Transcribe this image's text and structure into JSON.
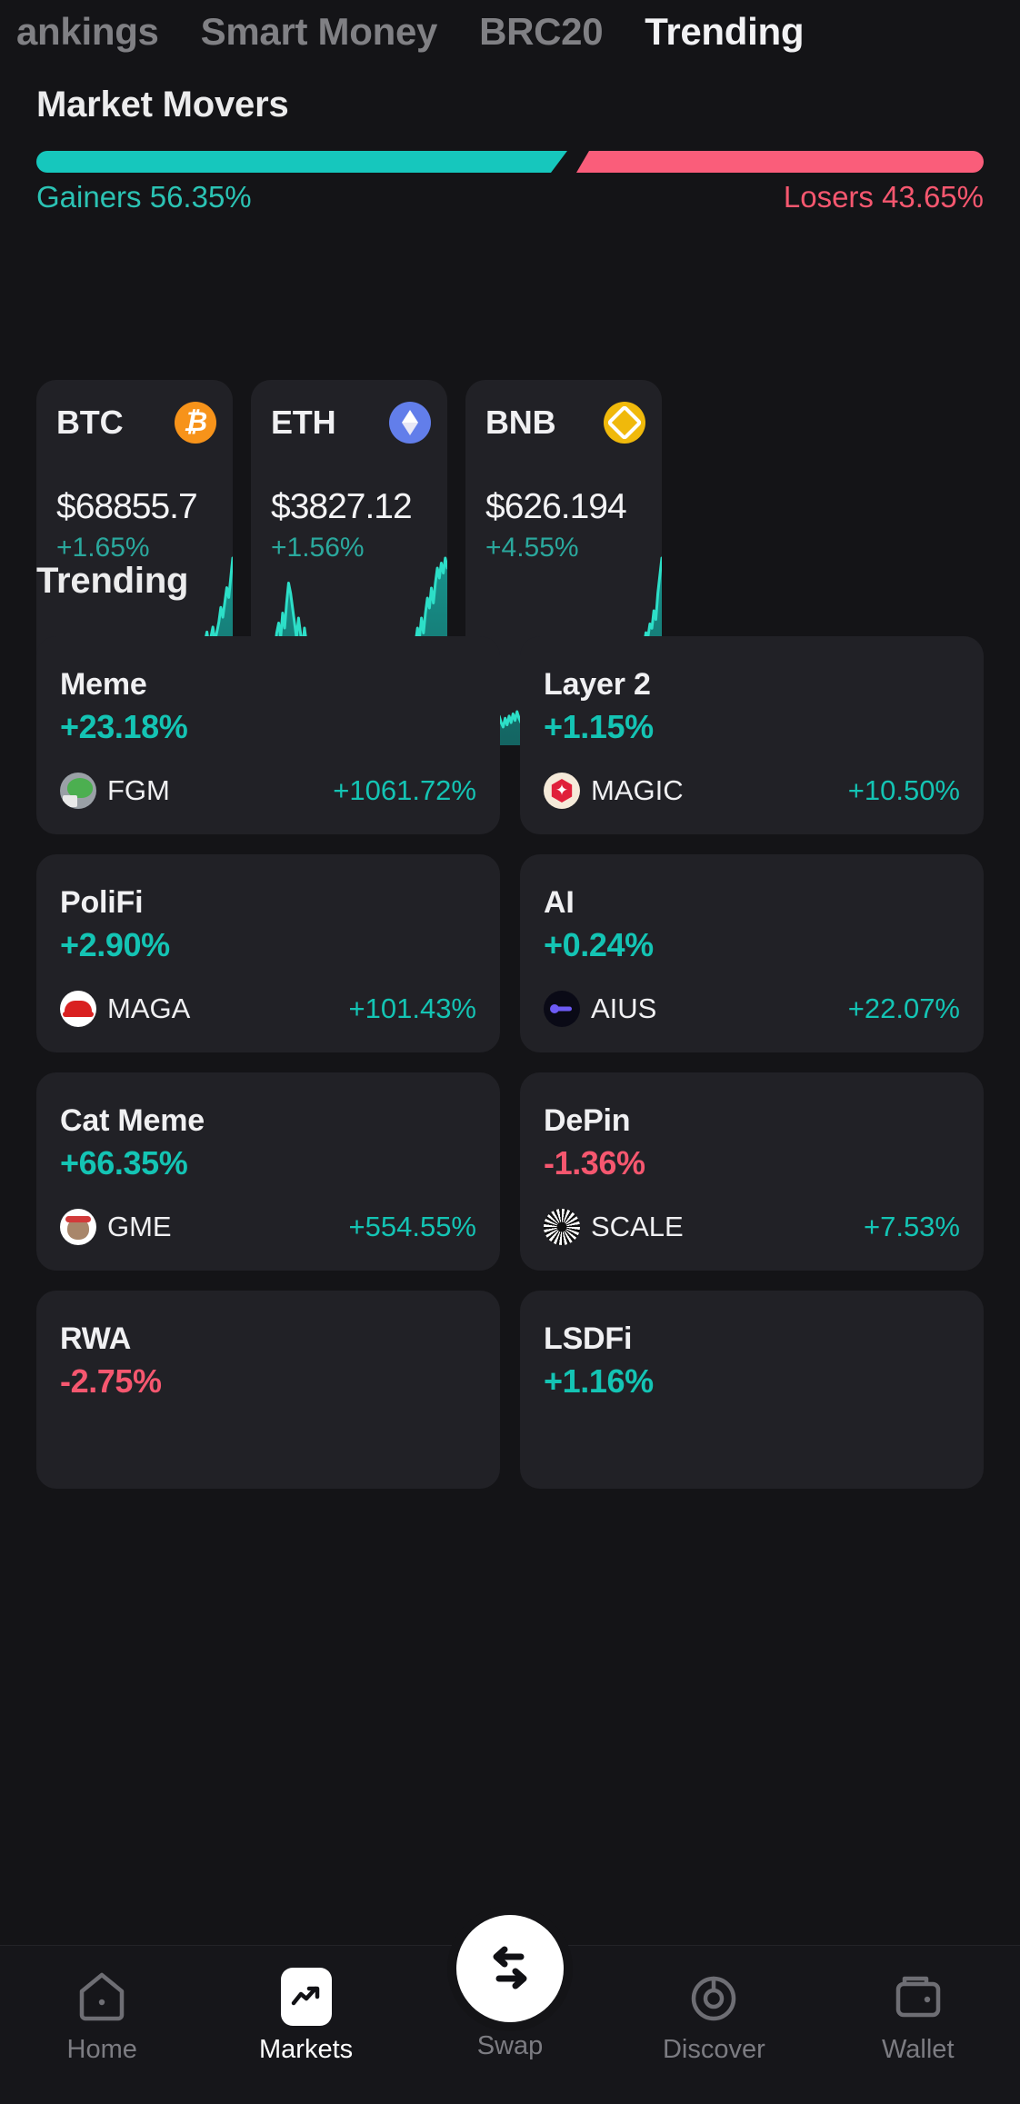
{
  "tabs": [
    {
      "label": "ankings",
      "active": false
    },
    {
      "label": "Smart Money",
      "active": false
    },
    {
      "label": "BRC20",
      "active": false
    },
    {
      "label": "Trending",
      "active": true
    }
  ],
  "market_movers": {
    "title": "Market Movers",
    "gainers_label": "Gainers 56.35%",
    "losers_label": "Losers 43.65%",
    "gainers_pct": 56.35,
    "losers_pct": 43.65,
    "gainers_color": "#16c7bd",
    "losers_color": "#fa5d7a",
    "cards": [
      {
        "symbol": "BTC",
        "price": "$68855.7",
        "change": "+1.65%",
        "icon": "bitcoin-icon",
        "icon_color": "#f7931a"
      },
      {
        "symbol": "ETH",
        "price": "$3827.12",
        "change": "+1.56%",
        "icon": "ethereum-icon",
        "icon_color": "#627eea"
      },
      {
        "symbol": "BNB",
        "price": "$626.194",
        "change": "+4.55%",
        "icon": "bnb-icon",
        "icon_color": "#f0b90b"
      }
    ]
  },
  "trending": {
    "title": "Trending",
    "cards": [
      {
        "name": "Meme",
        "change": "+23.18%",
        "dir": "up",
        "token": "FGM",
        "token_change": "+1061.72%",
        "token_dir": "up",
        "avatar": "pepe-avatar"
      },
      {
        "name": "Layer 2",
        "change": "+1.15%",
        "dir": "up",
        "token": "MAGIC",
        "token_change": "+10.50%",
        "token_dir": "up",
        "avatar": "magic-avatar"
      },
      {
        "name": "PoliFi",
        "change": "+2.90%",
        "dir": "up",
        "token": "MAGA",
        "token_change": "+101.43%",
        "token_dir": "up",
        "avatar": "maga-cap-avatar"
      },
      {
        "name": "AI",
        "change": "+0.24%",
        "dir": "up",
        "token": "AIUS",
        "token_change": "+22.07%",
        "token_dir": "up",
        "avatar": "aius-avatar"
      },
      {
        "name": "Cat Meme",
        "change": "+66.35%",
        "dir": "up",
        "token": "GME",
        "token_change": "+554.55%",
        "token_dir": "up",
        "avatar": "cat-avatar"
      },
      {
        "name": "DePin",
        "change": "-1.36%",
        "dir": "down",
        "token": "SCALE",
        "token_change": "+7.53%",
        "token_dir": "up",
        "avatar": "scale-avatar"
      },
      {
        "name": "RWA",
        "change": "-2.75%",
        "dir": "down",
        "token": "",
        "token_change": "",
        "token_dir": "down",
        "avatar": ""
      },
      {
        "name": "LSDFi",
        "change": "+1.16%",
        "dir": "up",
        "token": "",
        "token_change": "",
        "token_dir": "up",
        "avatar": ""
      }
    ],
    "up_color": "#14c4b4",
    "down_color": "#f6576f"
  },
  "bottom_nav": {
    "items": [
      {
        "label": "Home",
        "icon": "home-icon",
        "active": false
      },
      {
        "label": "Markets",
        "icon": "markets-icon",
        "active": true
      },
      {
        "label": "Swap",
        "icon": "swap-icon",
        "active": false
      },
      {
        "label": "Discover",
        "icon": "discover-icon",
        "active": false
      },
      {
        "label": "Wallet",
        "icon": "wallet-icon",
        "active": false
      }
    ]
  },
  "chart_data": [
    {
      "type": "line",
      "title": "BTC sparkline",
      "series": [
        {
          "name": "BTC",
          "values": [
            30,
            28,
            31,
            29,
            27,
            30,
            33,
            31,
            35,
            32,
            36,
            33,
            37,
            34,
            32,
            36,
            34,
            38,
            35,
            39,
            36,
            34,
            38,
            36,
            40,
            37,
            41,
            38,
            36,
            40,
            38,
            42,
            39,
            37,
            41,
            44,
            40,
            38,
            42,
            40,
            44,
            41,
            39,
            43,
            41,
            45,
            42,
            40,
            44,
            42,
            46,
            43,
            41,
            45,
            43,
            47,
            44,
            42,
            46,
            44,
            48,
            45,
            43,
            47,
            45,
            30,
            36,
            58,
            52,
            56,
            50,
            54,
            58,
            52,
            60,
            56,
            50,
            54,
            58,
            62,
            56,
            60,
            64,
            58,
            62,
            66,
            70,
            64,
            68,
            72,
            66,
            70,
            74,
            80,
            76,
            82,
            88,
            84,
            92,
            100
          ]
        }
      ],
      "xlabel": "",
      "ylabel": "",
      "grid": false,
      "legend": "none"
    },
    {
      "type": "line",
      "title": "ETH sparkline",
      "series": [
        {
          "name": "ETH",
          "values": [
            40,
            36,
            44,
            38,
            48,
            42,
            52,
            58,
            54,
            62,
            58,
            66,
            62,
            70,
            74,
            68,
            78,
            72,
            82,
            90,
            86,
            80,
            74,
            68,
            76,
            70,
            64,
            72,
            66,
            60,
            68,
            62,
            56,
            64,
            58,
            52,
            60,
            54,
            48,
            56,
            50,
            44,
            52,
            46,
            54,
            48,
            56,
            50,
            44,
            52,
            46,
            40,
            48,
            42,
            50,
            44,
            38,
            46,
            40,
            34,
            42,
            36,
            44,
            38,
            32,
            40,
            34,
            28,
            36,
            30,
            38,
            44,
            40,
            34,
            42,
            36,
            44,
            50,
            46,
            40,
            48,
            54,
            60,
            66,
            72,
            68,
            76,
            70,
            78,
            84,
            80,
            88,
            82,
            90,
            96,
            92,
            98,
            94,
            100,
            96
          ]
        }
      ],
      "xlabel": "",
      "ylabel": "",
      "grid": false,
      "legend": "none"
    },
    {
      "type": "line",
      "title": "BNB sparkline",
      "series": [
        {
          "name": "BNB",
          "values": [
            20,
            18,
            22,
            19,
            23,
            20,
            24,
            21,
            25,
            22,
            26,
            23,
            27,
            24,
            22,
            26,
            24,
            28,
            25,
            23,
            27,
            24,
            28,
            25,
            29,
            26,
            30,
            27,
            25,
            48,
            44,
            40,
            42,
            38,
            40,
            42,
            38,
            40,
            42,
            44,
            40,
            42,
            44,
            46,
            42,
            44,
            40,
            36,
            32,
            30,
            34,
            30,
            32,
            28,
            30,
            32,
            28,
            30,
            34,
            38,
            34,
            36,
            40,
            36,
            38,
            34,
            36,
            32,
            34,
            36,
            38,
            34,
            36,
            38,
            40,
            42,
            38,
            40,
            44,
            46,
            48,
            44,
            46,
            50,
            52,
            48,
            54,
            58,
            56,
            62,
            60,
            66,
            64,
            70,
            68,
            76,
            72,
            84,
            92,
            100
          ]
        }
      ],
      "xlabel": "",
      "ylabel": "",
      "grid": false,
      "legend": "none"
    }
  ]
}
